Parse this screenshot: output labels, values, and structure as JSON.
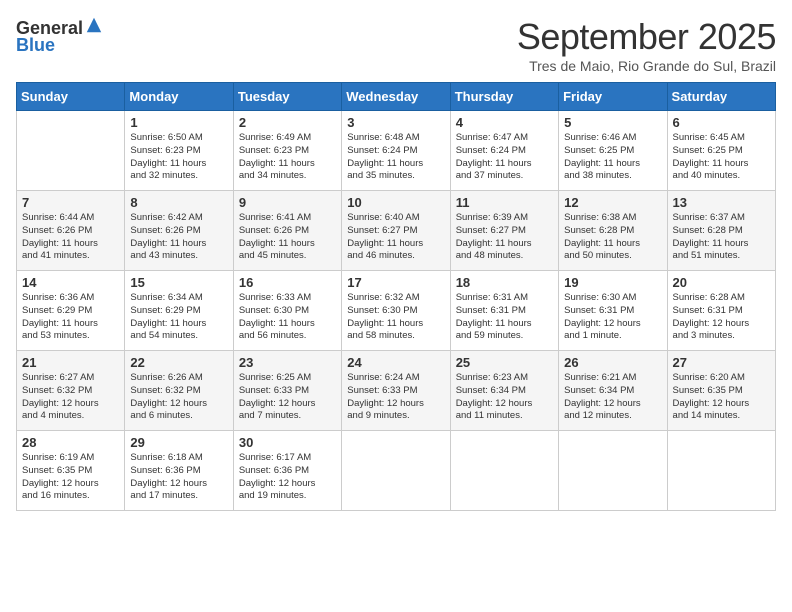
{
  "logo": {
    "general": "General",
    "blue": "Blue"
  },
  "title": "September 2025",
  "location": "Tres de Maio, Rio Grande do Sul, Brazil",
  "days_of_week": [
    "Sunday",
    "Monday",
    "Tuesday",
    "Wednesday",
    "Thursday",
    "Friday",
    "Saturday"
  ],
  "weeks": [
    [
      {
        "day": "",
        "info": ""
      },
      {
        "day": "1",
        "info": "Sunrise: 6:50 AM\nSunset: 6:23 PM\nDaylight: 11 hours\nand 32 minutes."
      },
      {
        "day": "2",
        "info": "Sunrise: 6:49 AM\nSunset: 6:23 PM\nDaylight: 11 hours\nand 34 minutes."
      },
      {
        "day": "3",
        "info": "Sunrise: 6:48 AM\nSunset: 6:24 PM\nDaylight: 11 hours\nand 35 minutes."
      },
      {
        "day": "4",
        "info": "Sunrise: 6:47 AM\nSunset: 6:24 PM\nDaylight: 11 hours\nand 37 minutes."
      },
      {
        "day": "5",
        "info": "Sunrise: 6:46 AM\nSunset: 6:25 PM\nDaylight: 11 hours\nand 38 minutes."
      },
      {
        "day": "6",
        "info": "Sunrise: 6:45 AM\nSunset: 6:25 PM\nDaylight: 11 hours\nand 40 minutes."
      }
    ],
    [
      {
        "day": "7",
        "info": "Sunrise: 6:44 AM\nSunset: 6:26 PM\nDaylight: 11 hours\nand 41 minutes."
      },
      {
        "day": "8",
        "info": "Sunrise: 6:42 AM\nSunset: 6:26 PM\nDaylight: 11 hours\nand 43 minutes."
      },
      {
        "day": "9",
        "info": "Sunrise: 6:41 AM\nSunset: 6:26 PM\nDaylight: 11 hours\nand 45 minutes."
      },
      {
        "day": "10",
        "info": "Sunrise: 6:40 AM\nSunset: 6:27 PM\nDaylight: 11 hours\nand 46 minutes."
      },
      {
        "day": "11",
        "info": "Sunrise: 6:39 AM\nSunset: 6:27 PM\nDaylight: 11 hours\nand 48 minutes."
      },
      {
        "day": "12",
        "info": "Sunrise: 6:38 AM\nSunset: 6:28 PM\nDaylight: 11 hours\nand 50 minutes."
      },
      {
        "day": "13",
        "info": "Sunrise: 6:37 AM\nSunset: 6:28 PM\nDaylight: 11 hours\nand 51 minutes."
      }
    ],
    [
      {
        "day": "14",
        "info": "Sunrise: 6:36 AM\nSunset: 6:29 PM\nDaylight: 11 hours\nand 53 minutes."
      },
      {
        "day": "15",
        "info": "Sunrise: 6:34 AM\nSunset: 6:29 PM\nDaylight: 11 hours\nand 54 minutes."
      },
      {
        "day": "16",
        "info": "Sunrise: 6:33 AM\nSunset: 6:30 PM\nDaylight: 11 hours\nand 56 minutes."
      },
      {
        "day": "17",
        "info": "Sunrise: 6:32 AM\nSunset: 6:30 PM\nDaylight: 11 hours\nand 58 minutes."
      },
      {
        "day": "18",
        "info": "Sunrise: 6:31 AM\nSunset: 6:31 PM\nDaylight: 11 hours\nand 59 minutes."
      },
      {
        "day": "19",
        "info": "Sunrise: 6:30 AM\nSunset: 6:31 PM\nDaylight: 12 hours\nand 1 minute."
      },
      {
        "day": "20",
        "info": "Sunrise: 6:28 AM\nSunset: 6:31 PM\nDaylight: 12 hours\nand 3 minutes."
      }
    ],
    [
      {
        "day": "21",
        "info": "Sunrise: 6:27 AM\nSunset: 6:32 PM\nDaylight: 12 hours\nand 4 minutes."
      },
      {
        "day": "22",
        "info": "Sunrise: 6:26 AM\nSunset: 6:32 PM\nDaylight: 12 hours\nand 6 minutes."
      },
      {
        "day": "23",
        "info": "Sunrise: 6:25 AM\nSunset: 6:33 PM\nDaylight: 12 hours\nand 7 minutes."
      },
      {
        "day": "24",
        "info": "Sunrise: 6:24 AM\nSunset: 6:33 PM\nDaylight: 12 hours\nand 9 minutes."
      },
      {
        "day": "25",
        "info": "Sunrise: 6:23 AM\nSunset: 6:34 PM\nDaylight: 12 hours\nand 11 minutes."
      },
      {
        "day": "26",
        "info": "Sunrise: 6:21 AM\nSunset: 6:34 PM\nDaylight: 12 hours\nand 12 minutes."
      },
      {
        "day": "27",
        "info": "Sunrise: 6:20 AM\nSunset: 6:35 PM\nDaylight: 12 hours\nand 14 minutes."
      }
    ],
    [
      {
        "day": "28",
        "info": "Sunrise: 6:19 AM\nSunset: 6:35 PM\nDaylight: 12 hours\nand 16 minutes."
      },
      {
        "day": "29",
        "info": "Sunrise: 6:18 AM\nSunset: 6:36 PM\nDaylight: 12 hours\nand 17 minutes."
      },
      {
        "day": "30",
        "info": "Sunrise: 6:17 AM\nSunset: 6:36 PM\nDaylight: 12 hours\nand 19 minutes."
      },
      {
        "day": "",
        "info": ""
      },
      {
        "day": "",
        "info": ""
      },
      {
        "day": "",
        "info": ""
      },
      {
        "day": "",
        "info": ""
      }
    ]
  ]
}
